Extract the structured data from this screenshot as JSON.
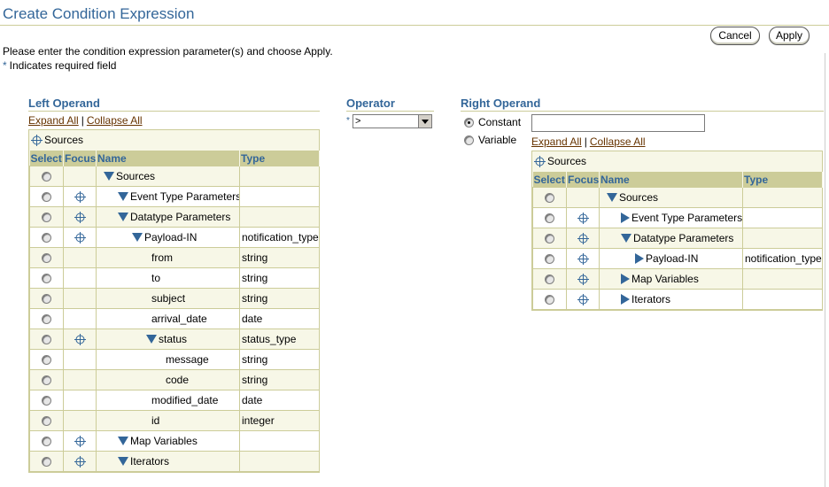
{
  "page": {
    "title": "Create Condition Expression",
    "instructions": "Please enter the condition expression parameter(s) and choose Apply.",
    "required_note": "Indicates required field",
    "required_marker": "*",
    "cancel_label": "Cancel",
    "apply_label": "Apply"
  },
  "left": {
    "heading": "Left Operand",
    "expand_all": "Expand All",
    "collapse_all": "Collapse All",
    "separator": "|",
    "sources_label": "Sources",
    "columns": {
      "select": "Select",
      "focus": "Focus",
      "name": "Name",
      "type": "Type"
    },
    "rows": [
      {
        "name": "Sources",
        "type": "",
        "level": 0,
        "icon": "expanded",
        "focus": false
      },
      {
        "name": "Event Type Parameters",
        "type": "",
        "level": 1,
        "icon": "expanded",
        "focus": true
      },
      {
        "name": "Datatype Parameters",
        "type": "",
        "level": 1,
        "icon": "expanded",
        "focus": true
      },
      {
        "name": "Payload-IN",
        "type": "notification_type",
        "level": 2,
        "icon": "expanded",
        "focus": true
      },
      {
        "name": "from",
        "type": "string",
        "level": 3,
        "icon": "none",
        "focus": false
      },
      {
        "name": "to",
        "type": "string",
        "level": 3,
        "icon": "none",
        "focus": false
      },
      {
        "name": "subject",
        "type": "string",
        "level": 3,
        "icon": "none",
        "focus": false
      },
      {
        "name": "arrival_date",
        "type": "date",
        "level": 3,
        "icon": "none",
        "focus": false
      },
      {
        "name": "status",
        "type": "status_type",
        "level": 3,
        "icon": "expanded",
        "focus": true
      },
      {
        "name": "message",
        "type": "string",
        "level": 4,
        "icon": "none",
        "focus": false
      },
      {
        "name": "code",
        "type": "string",
        "level": 4,
        "icon": "none",
        "focus": false
      },
      {
        "name": "modified_date",
        "type": "date",
        "level": 3,
        "icon": "none",
        "focus": false
      },
      {
        "name": "id",
        "type": "integer",
        "level": 3,
        "icon": "none",
        "focus": false
      },
      {
        "name": "Map Variables",
        "type": "",
        "level": 1,
        "icon": "expanded",
        "focus": true
      },
      {
        "name": "Iterators",
        "type": "",
        "level": 1,
        "icon": "expanded",
        "focus": true
      }
    ]
  },
  "operator": {
    "heading": "Operator",
    "required_marker": "*",
    "selected": ">"
  },
  "right": {
    "heading": "Right Operand",
    "constant_label": "Constant",
    "variable_label": "Variable",
    "constant_value": "",
    "selected_mode": "constant",
    "expand_all": "Expand All",
    "collapse_all": "Collapse All",
    "separator": "|",
    "sources_label": "Sources",
    "columns": {
      "select": "Select",
      "focus": "Focus",
      "name": "Name",
      "type": "Type"
    },
    "rows": [
      {
        "name": "Sources",
        "type": "",
        "level": 0,
        "icon": "expanded",
        "focus": false
      },
      {
        "name": "Event Type Parameters",
        "type": "",
        "level": 1,
        "icon": "collapsed",
        "focus": true
      },
      {
        "name": "Datatype Parameters",
        "type": "",
        "level": 1,
        "icon": "expanded",
        "focus": true
      },
      {
        "name": "Payload-IN",
        "type": "notification_type",
        "level": 2,
        "icon": "collapsed",
        "focus": true
      },
      {
        "name": "Map Variables",
        "type": "",
        "level": 1,
        "icon": "collapsed",
        "focus": true
      },
      {
        "name": "Iterators",
        "type": "",
        "level": 1,
        "icon": "collapsed",
        "focus": true
      }
    ]
  },
  "colors": {
    "accent": "#336699",
    "header_bg": "#cccc99",
    "panel_bg": "#f7f7e7",
    "link": "#663300"
  },
  "icons": {
    "focus": "crosshair-icon",
    "expanded": "triangle-down-icon",
    "collapsed": "triangle-right-icon"
  }
}
